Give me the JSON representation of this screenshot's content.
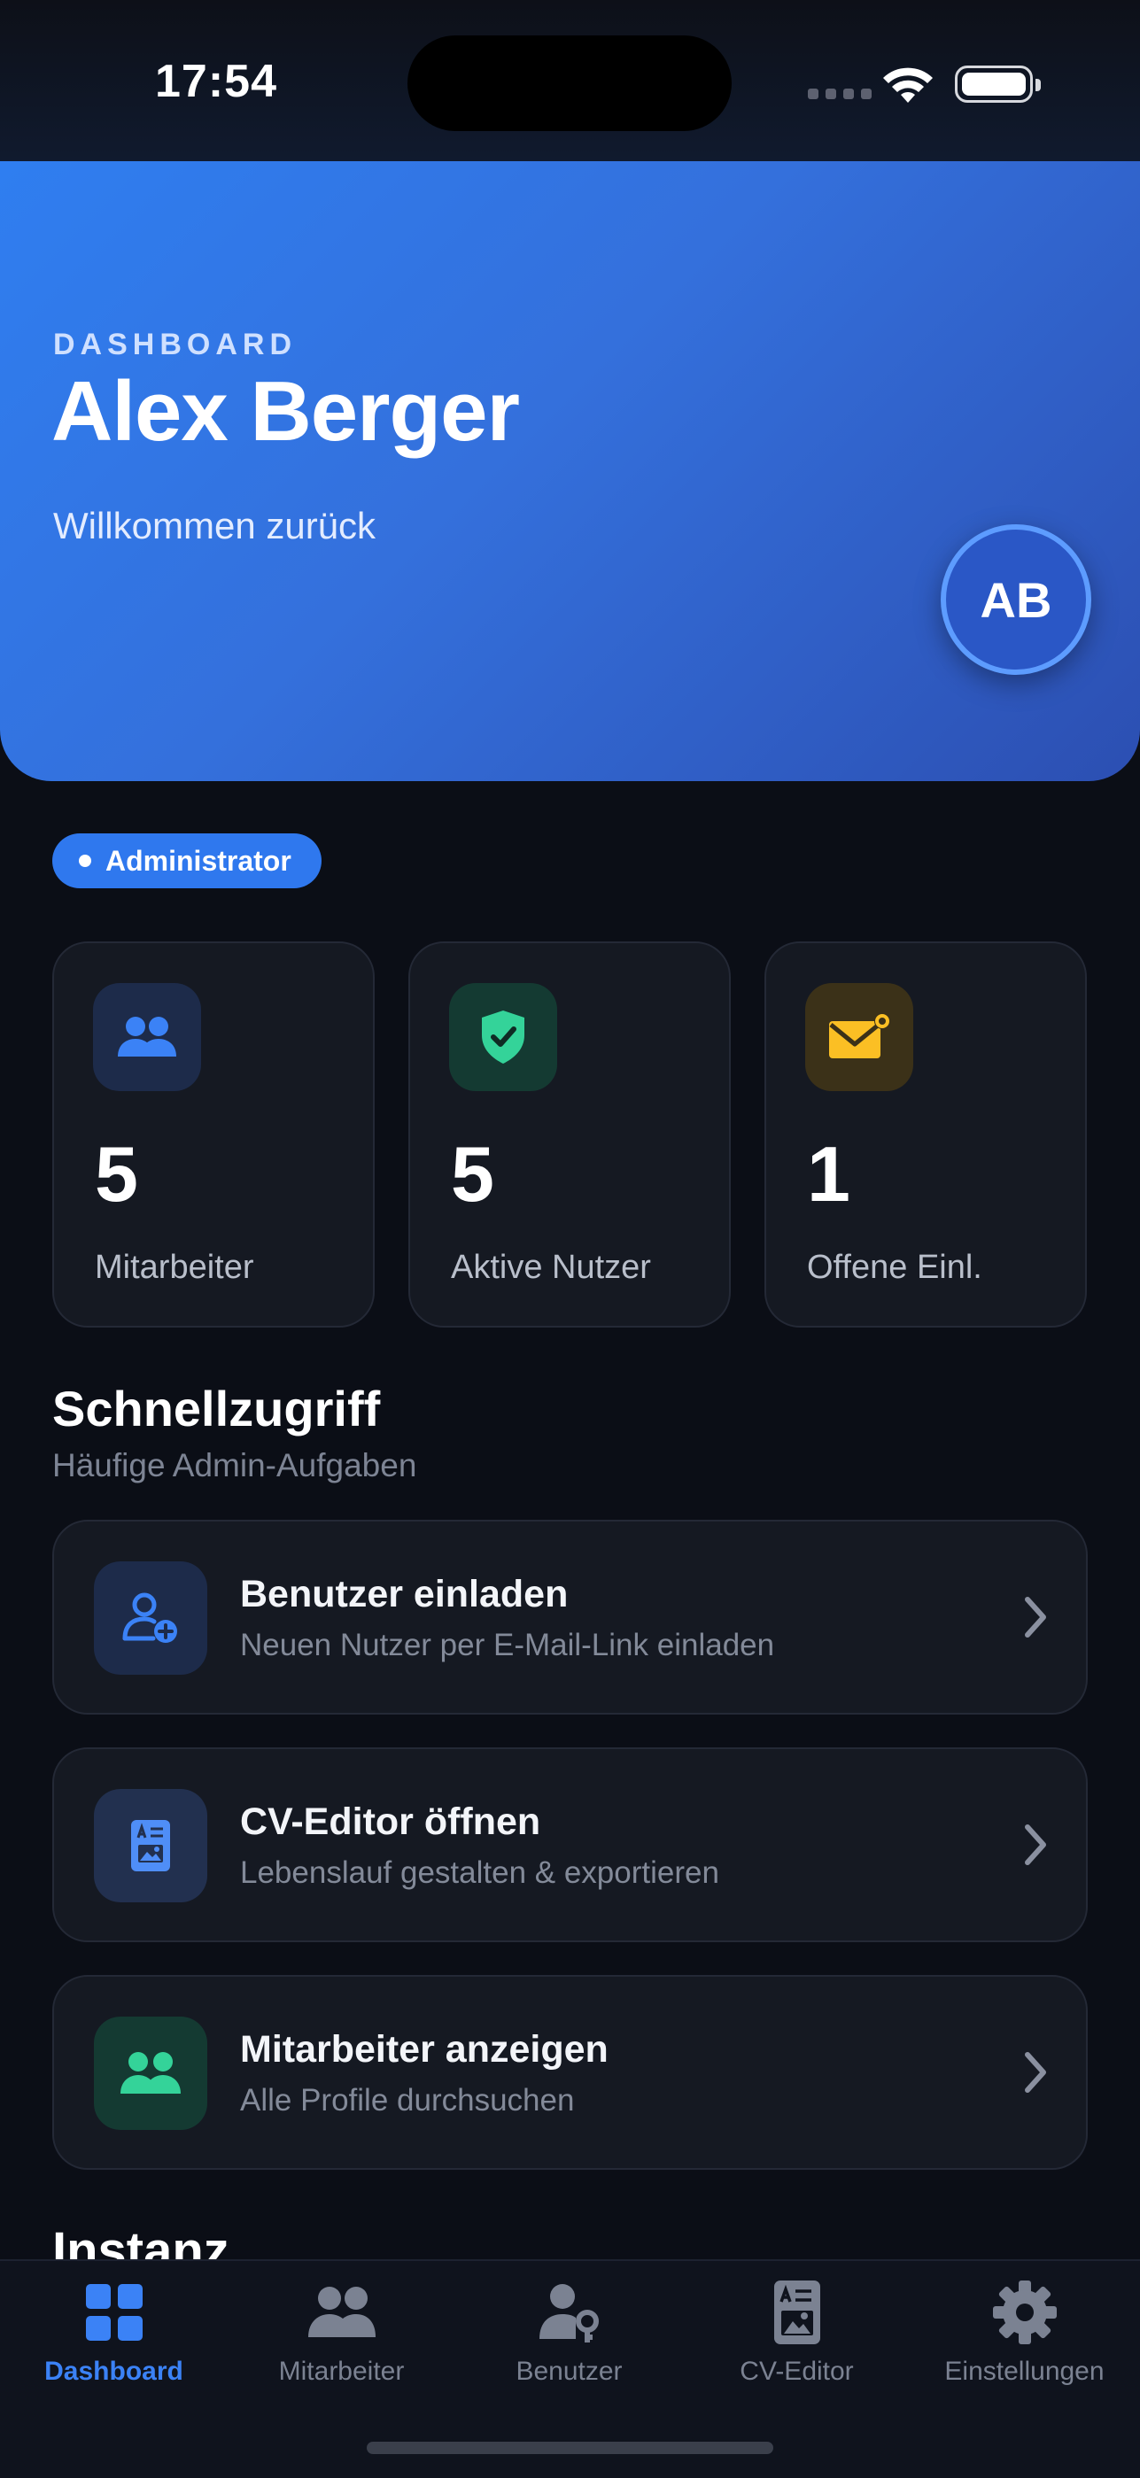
{
  "status_bar": {
    "time": "17:54"
  },
  "header": {
    "eyebrow": "DASHBOARD",
    "name": "Alex Berger",
    "greeting": "Willkommen zurück",
    "avatar_initials": "AB"
  },
  "role_badge": "Administrator",
  "stats": [
    {
      "value": "5",
      "label": "Mitarbeiter",
      "icon": "users-icon",
      "color": "#3b82f6"
    },
    {
      "value": "5",
      "label": "Aktive Nutzer",
      "icon": "shield-check-icon",
      "color": "#34d399"
    },
    {
      "value": "1",
      "label": "Offene Einl.",
      "icon": "mail-badge-icon",
      "color": "#fbbf24"
    }
  ],
  "quick_access": {
    "title": "Schnellzugriff",
    "subtitle": "Häufige Admin-Aufgaben",
    "actions": [
      {
        "title": "Benutzer einladen",
        "subtitle": "Neuen Nutzer per E-Mail-Link einladen",
        "icon": "user-plus-icon"
      },
      {
        "title": "CV-Editor öffnen",
        "subtitle": "Lebenslauf gestalten & exportieren",
        "icon": "document-icon"
      },
      {
        "title": "Mitarbeiter anzeigen",
        "subtitle": "Alle Profile durchsuchen",
        "icon": "users-icon"
      }
    ]
  },
  "next_section_title": "Instanz",
  "tabbar": {
    "active": "Dashboard",
    "tabs": [
      {
        "label": "Dashboard",
        "icon": "grid-icon"
      },
      {
        "label": "Mitarbeiter",
        "icon": "users-icon"
      },
      {
        "label": "Benutzer",
        "icon": "user-key-icon"
      },
      {
        "label": "CV-Editor",
        "icon": "document-icon"
      },
      {
        "label": "Einstellungen",
        "icon": "gear-icon"
      }
    ]
  },
  "colors": {
    "accent": "#3b82f6",
    "background": "#0b0e16",
    "card": "#151922",
    "success": "#34d399",
    "warning": "#fbbf24"
  }
}
